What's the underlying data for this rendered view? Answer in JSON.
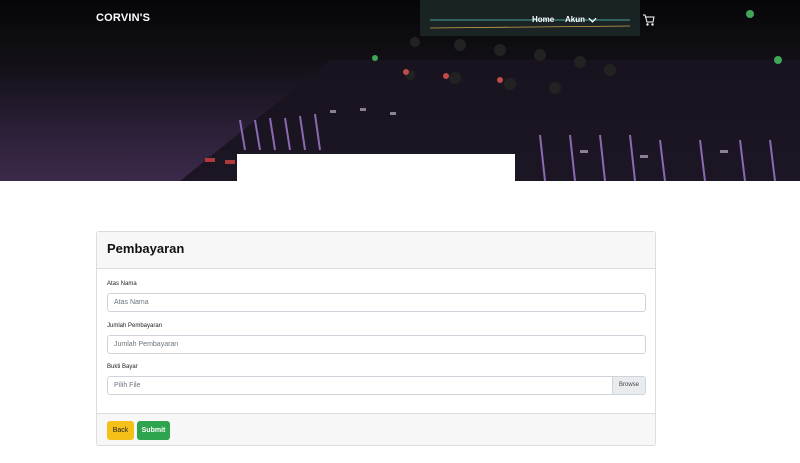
{
  "navbar": {
    "brand": "CORVIN'S",
    "home_label": "Home",
    "account_label": "Akun",
    "account_icon": "chevron-down-icon",
    "cart_icon": "cart-icon"
  },
  "payment_card": {
    "title": "Pembayaran",
    "fields": {
      "name_label": "Atas Nama",
      "name_placeholder": "Atas Nama",
      "amount_label": "Jumlah Pembayaran",
      "amount_placeholder": "Jumlah Pembayaran",
      "proof_label": "Bukti Bayar",
      "proof_placeholder": "Pilih File",
      "browse_label": "Browse"
    },
    "buttons": {
      "back_label": "Back",
      "submit_label": "Submit"
    }
  },
  "colors": {
    "back_button": "#f5c018",
    "submit_button": "#2ea44f",
    "hero_overlay": "#2a1f36"
  }
}
